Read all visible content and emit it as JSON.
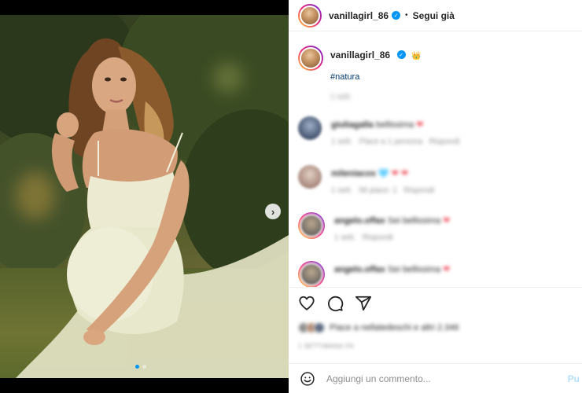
{
  "post": {
    "author": {
      "username": "vanillagirl_86",
      "verified": true,
      "follow_status": "Segui già",
      "separator": "•"
    },
    "caption": {
      "username": "vanillagirl_86",
      "emoji": "👑",
      "hashtag": "#natura",
      "meta": "1 sett."
    },
    "carousel": {
      "slide_count": 2,
      "active_slide": 1,
      "next_icon": "chevron-right-icon"
    },
    "comments": [
      {
        "user": "giuliagalla",
        "text": "bellissima",
        "emoji": "❤",
        "meta": [
          "1 sett.",
          "Piace a 1 persona",
          "Rispondi"
        ]
      },
      {
        "user": "mileniacos",
        "text": "",
        "emoji": "🩵 ❤ ❤",
        "meta": [
          "1 sett.",
          "Mi piace: 1",
          "Rispondi"
        ]
      },
      {
        "user": "angelo.offax",
        "text": "Sei bellissima",
        "emoji": "❤",
        "meta": [
          "1 sett.",
          "Rispondi"
        ]
      },
      {
        "user": "angelo.offax",
        "text": "Sei bellissima",
        "emoji": "❤",
        "meta": []
      }
    ],
    "actions": {
      "icons": [
        "heart-icon",
        "comment-icon",
        "share-icon"
      ]
    },
    "likes": {
      "text": "Piace a nellatedeschi e altri 2.346"
    },
    "date": "1 SETTIMANA FA",
    "composer": {
      "placeholder": "Aggiungi un commento...",
      "publish_label": "Pu",
      "emoji_icon": "smiley-icon"
    },
    "colors": {
      "accent": "#0095f6",
      "link": "#00376b",
      "heart": "#ed4956",
      "muted": "#8e8e8e"
    }
  }
}
